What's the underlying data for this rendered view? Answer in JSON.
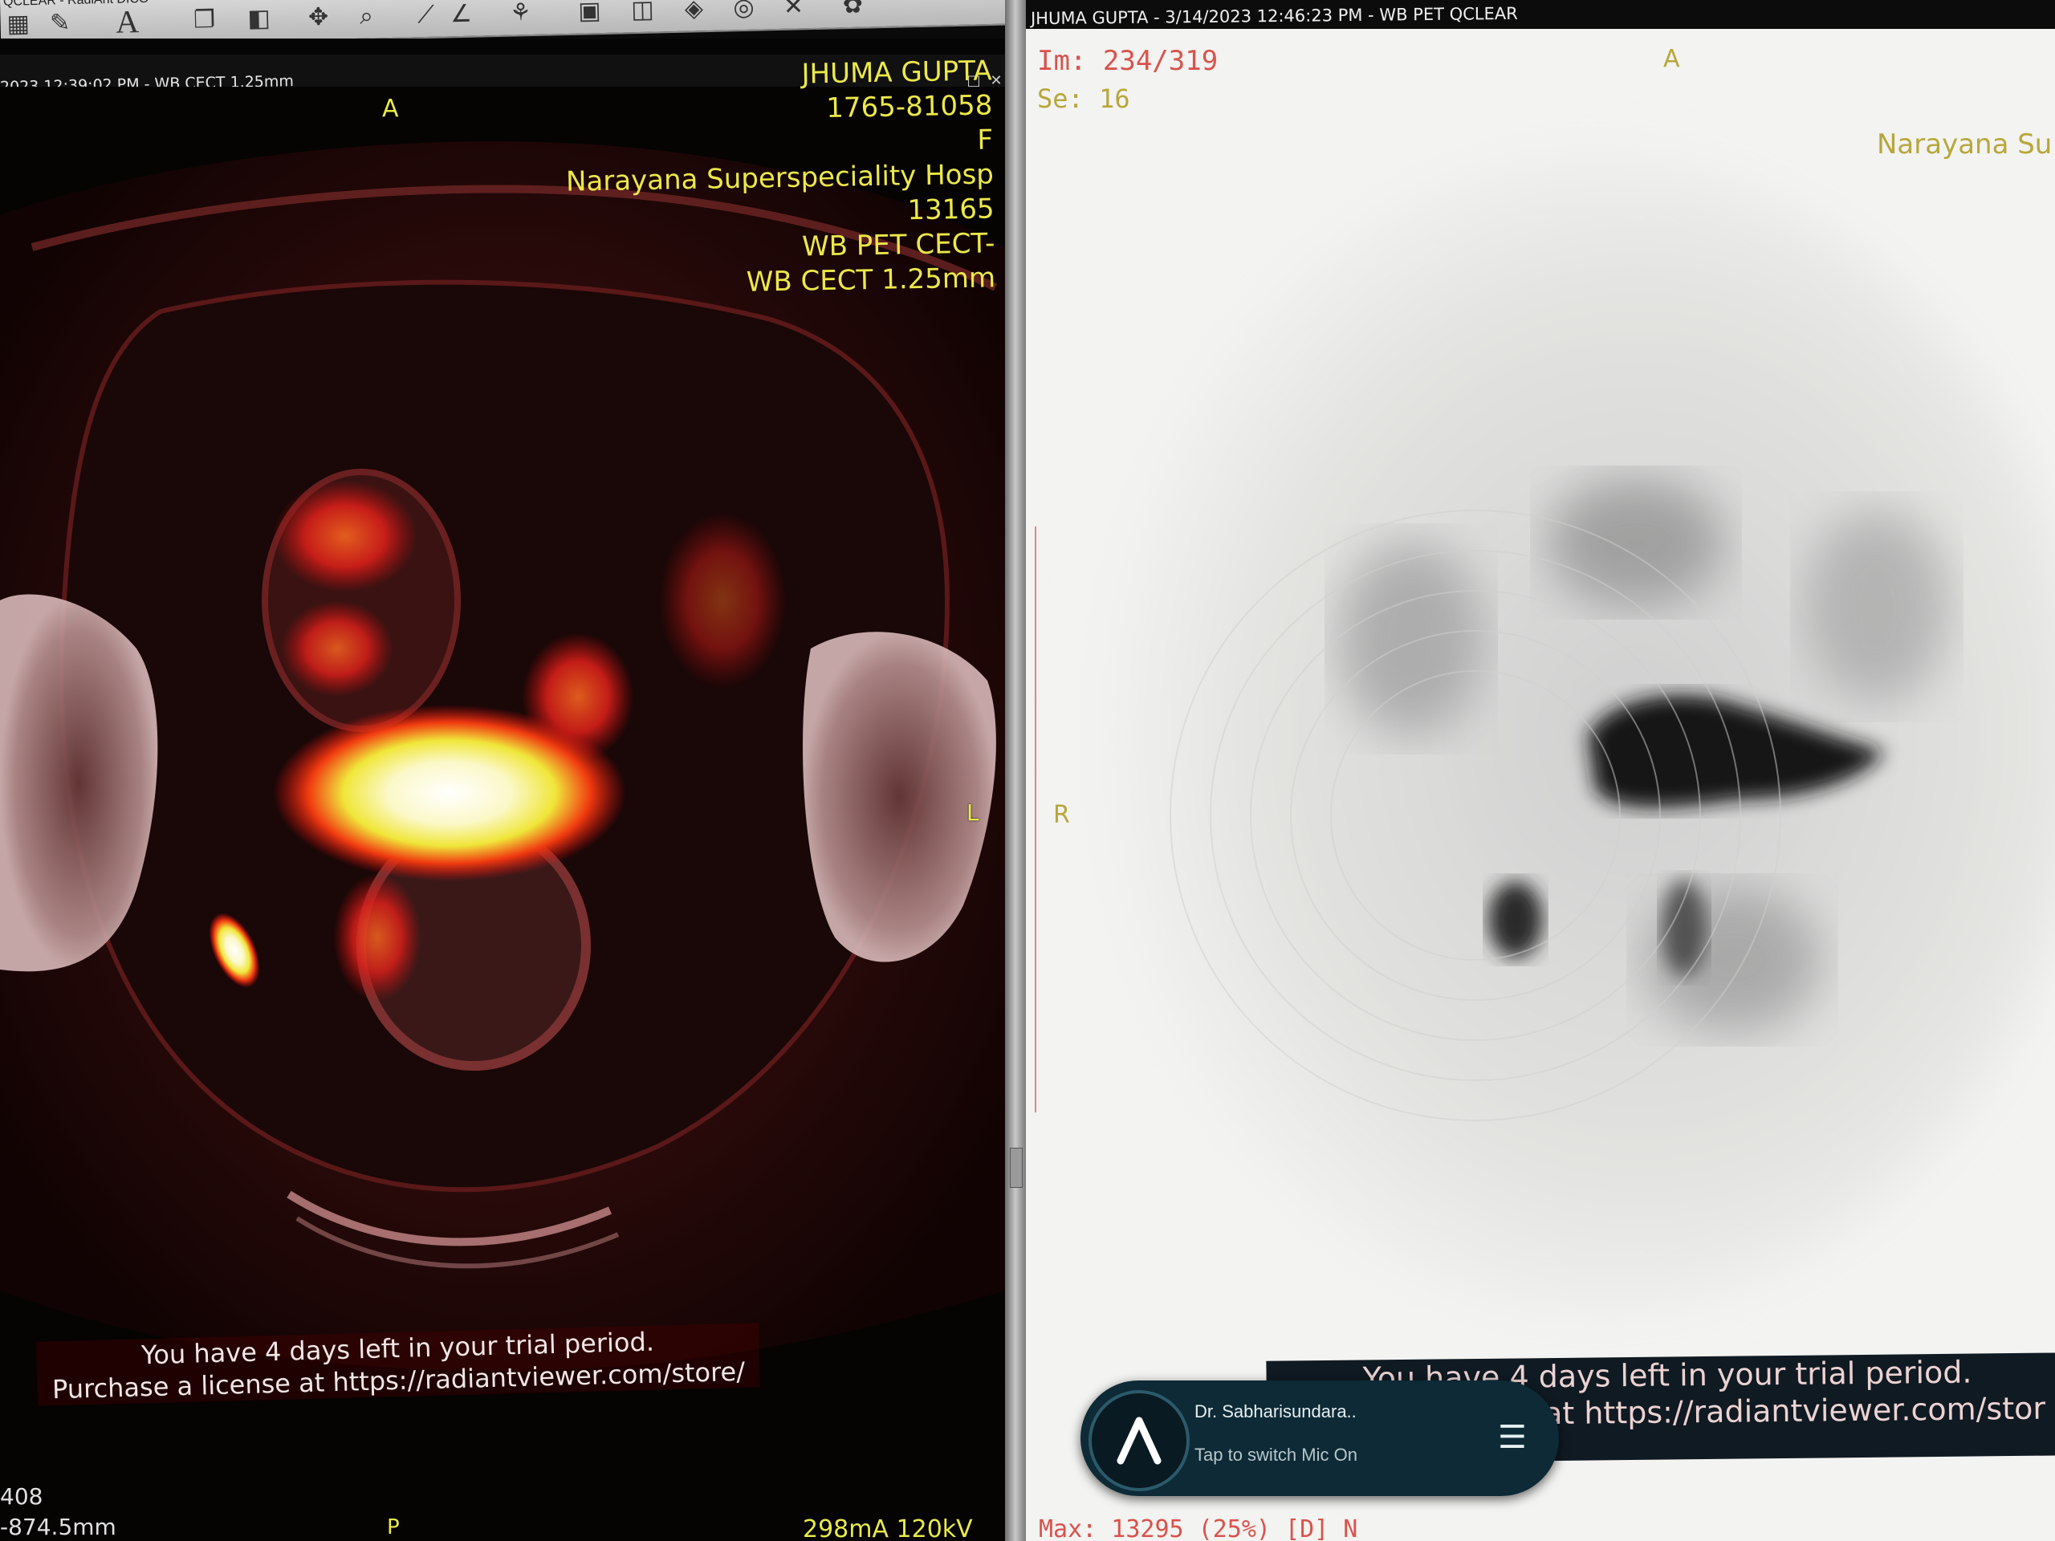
{
  "toolbar": {
    "app_title": "QCLEAR - RadiAnt DICO",
    "icons": [
      "grid-layout-icon",
      "pen-annotate-icon",
      "text-tool-icon",
      "series-stack-icon",
      "window-level-icon",
      "pan-icon",
      "zoom-icon",
      "measure-icon",
      "angle-icon",
      "fusion-icon",
      "cine-icon",
      "mpr-icon",
      "3d-icon",
      "cd-icon",
      "close-image-icon",
      "plugin-icon"
    ]
  },
  "left_viewport": {
    "series_header": "2023 12:39:02 PM - WB CECT 1.25mm",
    "orientation": {
      "top": "A",
      "right": "L",
      "bottom": "P"
    },
    "patient_info": {
      "name": "JHUMA GUPTA",
      "id": "1765-81058",
      "sex": "F",
      "institution": "Narayana Superspeciality Hosp",
      "accession": "13165",
      "study": "WB PET CECT-",
      "series": "WB CECT 1.25mm"
    },
    "bottom_left_line1": "408",
    "bottom_left_line2": "-874.5mm",
    "bottom_right": "298mA 120kV",
    "trial_line1": "You have 4 days left in your trial period.",
    "trial_line2": "Purchase a license at https://radiantviewer.com/store/"
  },
  "right_viewport": {
    "series_header": "JHUMA GUPTA - 3/14/2023 12:46:23 PM - WB PET QCLEAR",
    "image_counter": "Im: 234/319",
    "series_number": "Se: 16",
    "orientation": {
      "top": "A",
      "left": "R"
    },
    "institution": "Narayana Su",
    "trial_line1": "You have 4 days left in your trial period.",
    "trial_line2": "at https://radiantviewer.com/stor",
    "bottom_left": "Max: 13295 (25%) [D] N"
  },
  "call_widget": {
    "name": "Dr. Sabharisundara..",
    "subtitle": "Tap to switch Mic On",
    "logo_icon": "app-logo-icon",
    "menu_icon": "hamburger-menu-icon"
  }
}
